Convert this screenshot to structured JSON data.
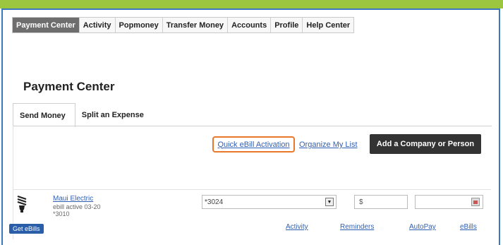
{
  "nav": {
    "tabs": [
      "Payment Center",
      "Activity",
      "Popmoney",
      "Transfer Money",
      "Accounts",
      "Profile",
      "Help Center"
    ]
  },
  "page": {
    "title": "Payment Center",
    "tabs": [
      "Send Money",
      "Split an Expense"
    ]
  },
  "actions": {
    "quick_ebill": "Quick eBill Activation",
    "organize": "Organize My List",
    "add_button": "Add a Company or Person"
  },
  "payee": {
    "name": "Maui Electric",
    "status": "ebill active 03-20",
    "account": "*3010",
    "pay_from": "*3024",
    "amount_prefix": "$",
    "get_ebills": "Get eBills",
    "links": [
      "Activity",
      "Reminders",
      "AutoPay",
      "eBills"
    ]
  },
  "colors": {
    "top_accent": "#9cc63f",
    "frame_border": "#3b78c0",
    "highlight": "#e8782a",
    "link": "#2f5fb3"
  }
}
